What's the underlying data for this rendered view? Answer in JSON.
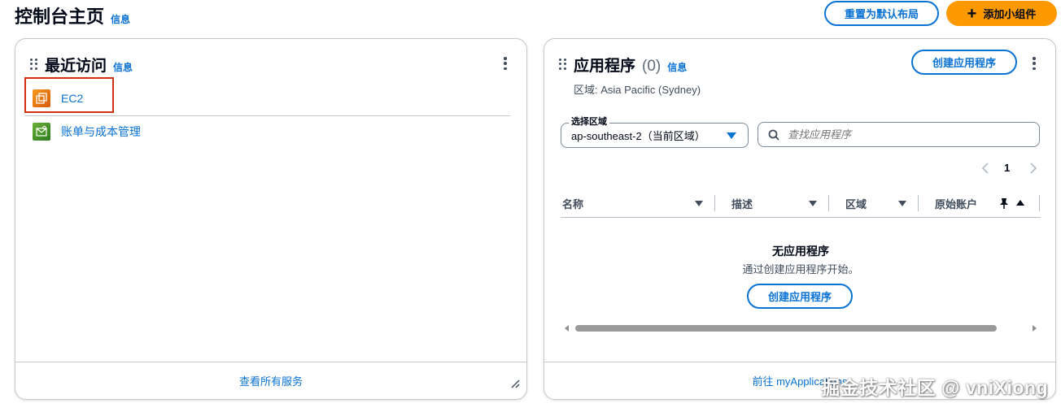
{
  "page": {
    "title": "控制台主页",
    "info_label": "信息",
    "reset_button": "重置为默认布局",
    "add_widget_button": "添加小组件",
    "add_icon": "plus-icon"
  },
  "recent": {
    "title": "最近访问",
    "info_label": "信息",
    "items": [
      {
        "label": "EC2",
        "icon": "ec2-icon",
        "icon_color": "#ed7100"
      },
      {
        "label": "账单与成本管理",
        "icon": "billing-icon",
        "icon_color": "#3f8624"
      }
    ],
    "footer_link": "查看所有服务"
  },
  "apps": {
    "title": "应用程序",
    "count": "(0)",
    "info_label": "信息",
    "region_text": "区域: Asia Pacific (Sydney)",
    "create_button": "创建应用程序",
    "select_label": "选择区域",
    "select_value": "ap-southeast-2（当前区域）",
    "search_placeholder": "查找应用程序",
    "pagination": {
      "current_page": "1"
    },
    "columns": [
      "名称",
      "描述",
      "区域",
      "原始账户"
    ],
    "empty_title": "无应用程序",
    "empty_desc": "通过创建应用程序开始。",
    "empty_create_button": "创建应用程序",
    "footer_link": "前往 myApplications"
  },
  "watermark": "掘金技术社区 @ vniXiong",
  "colors": {
    "link": "#0972d3",
    "primary": "#ff9900",
    "highlight_box": "#d13212",
    "text": "#000716"
  }
}
